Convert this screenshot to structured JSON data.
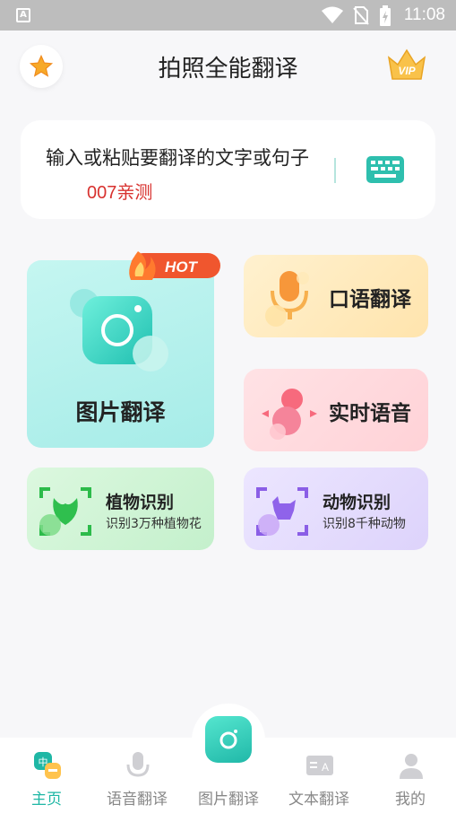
{
  "status": {
    "time": "11:08",
    "app_letter": "A"
  },
  "header": {
    "title": "拍照全能翻译",
    "star_icon": "star-icon",
    "vip_label": "VIP"
  },
  "input": {
    "placeholder": "输入或粘贴要翻译的文字或句子",
    "tag": "007亲测",
    "keyboard_icon": "keyboard-icon"
  },
  "features": {
    "photo": {
      "label": "图片翻译",
      "badge": "HOT"
    },
    "oral": {
      "label": "口语翻译"
    },
    "realtime": {
      "label": "实时语音"
    },
    "plant": {
      "label": "植物识别",
      "sub": "识别3万种植物花"
    },
    "animal": {
      "label": "动物识别",
      "sub": "识别8千种动物"
    }
  },
  "tabs": [
    {
      "label": "主页",
      "active": true
    },
    {
      "label": "语音翻译",
      "active": false
    },
    {
      "label": "图片翻译",
      "active": false
    },
    {
      "label": "文本翻译",
      "active": false
    },
    {
      "label": "我的",
      "active": false
    }
  ],
  "colors": {
    "accent": "#1fb7a5",
    "tag_red": "#d8322f",
    "vip_gold": "#f5b53a"
  }
}
